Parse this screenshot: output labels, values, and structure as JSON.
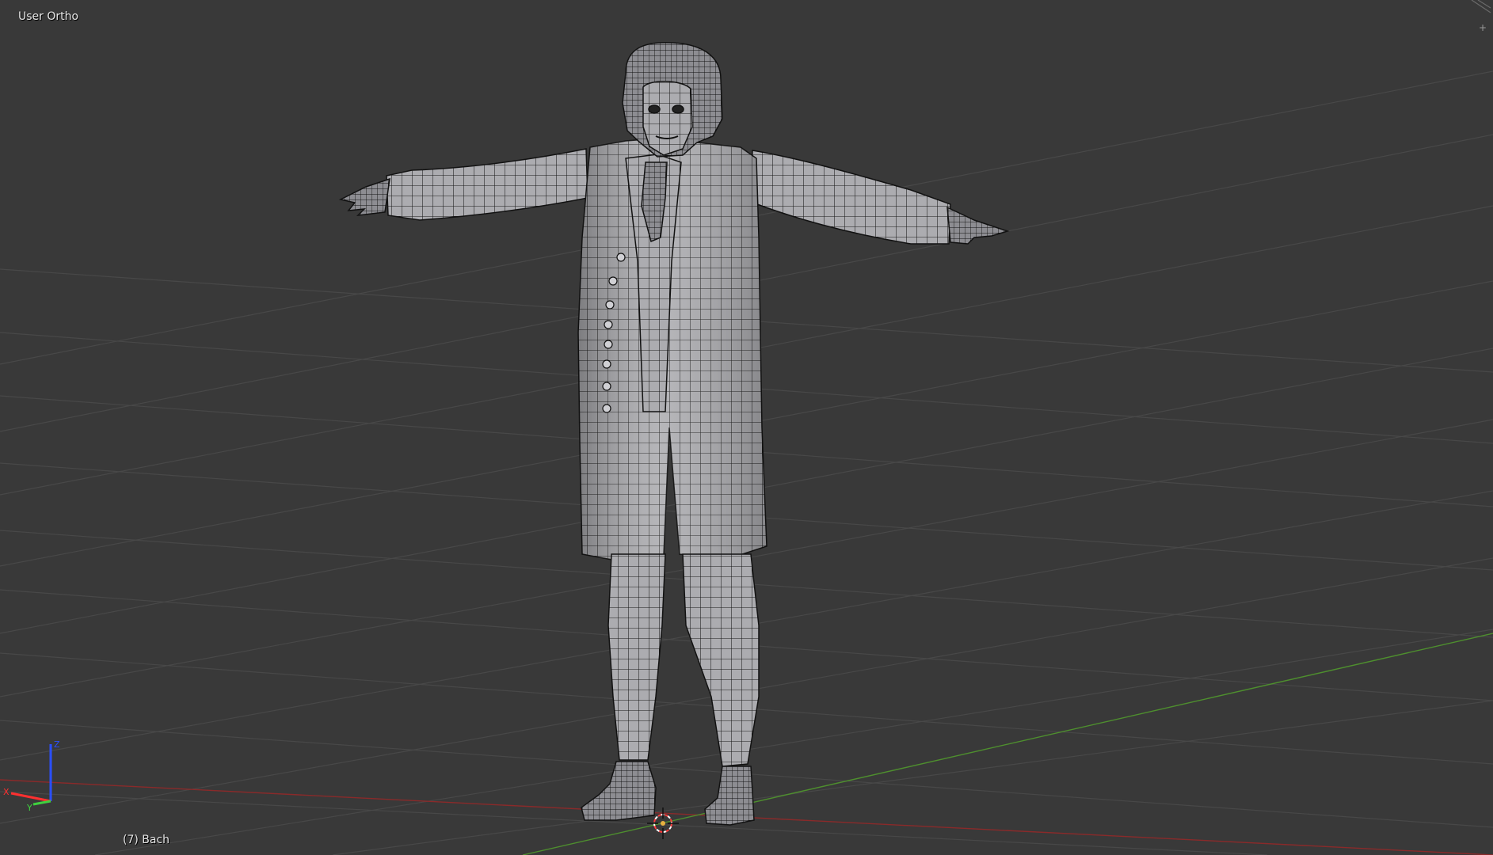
{
  "viewport": {
    "view_label": "User Ortho",
    "object_label": "(7) Bach",
    "background_color": "#393939",
    "grid_color": "#484848",
    "x_axis_color": "#8a2a2a",
    "y_axis_color": "#4e8f2e",
    "mesh_fill_color": "#a9a9ad",
    "wire_color": "#151515"
  },
  "axes_gizmo": {
    "z_label": "Z",
    "x_label": "X",
    "y_label": "Y",
    "z_color": "#2a4fff",
    "x_color": "#ff3030",
    "y_color": "#3fd03f"
  },
  "icons": {
    "cursor": "3d-cursor-icon",
    "corner": "area-split-icon",
    "plus": "plus-icon"
  }
}
